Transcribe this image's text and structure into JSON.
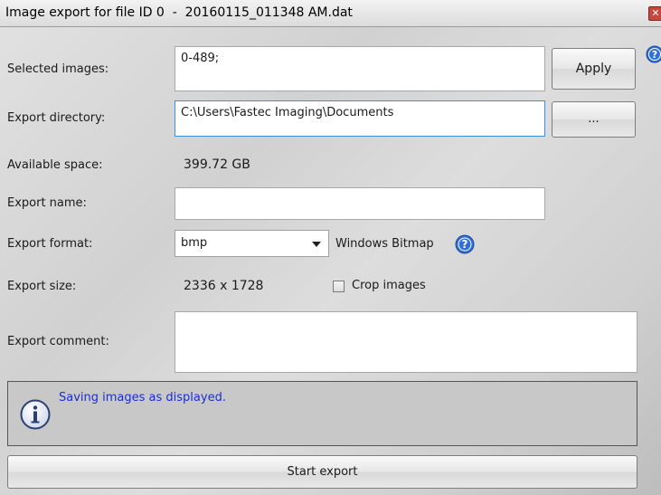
{
  "window": {
    "title": "Image export for file ID 0  -  20160115_011348 AM.dat",
    "close_glyph": "✕"
  },
  "form": {
    "selected_images": {
      "label": "Selected images:",
      "value": "0-489;"
    },
    "apply_button": "Apply",
    "export_directory": {
      "label": "Export directory:",
      "value": "C:\\Users\\Fastec Imaging\\Documents"
    },
    "browse_button": "...",
    "available_space": {
      "label": "Available space:",
      "value": "399.72 GB"
    },
    "export_name": {
      "label": "Export name:",
      "value": ""
    },
    "export_format": {
      "label": "Export format:",
      "selected": "bmp",
      "description": "Windows Bitmap"
    },
    "export_size": {
      "label": "Export size:",
      "value": "2336 x 1728"
    },
    "crop_images": {
      "label": "Crop images",
      "checked": false
    },
    "export_comment": {
      "label": "Export comment:",
      "value": ""
    }
  },
  "info": {
    "message": "Saving images as displayed."
  },
  "start_button": "Start export",
  "icons": {
    "help": "help-icon",
    "info": "info-icon",
    "close": "close-icon",
    "dropdown": "chevron-down-icon"
  },
  "colors": {
    "help_icon": "#2f6fd6",
    "info_text": "#1a2fd1",
    "close_button": "#c9463d"
  }
}
